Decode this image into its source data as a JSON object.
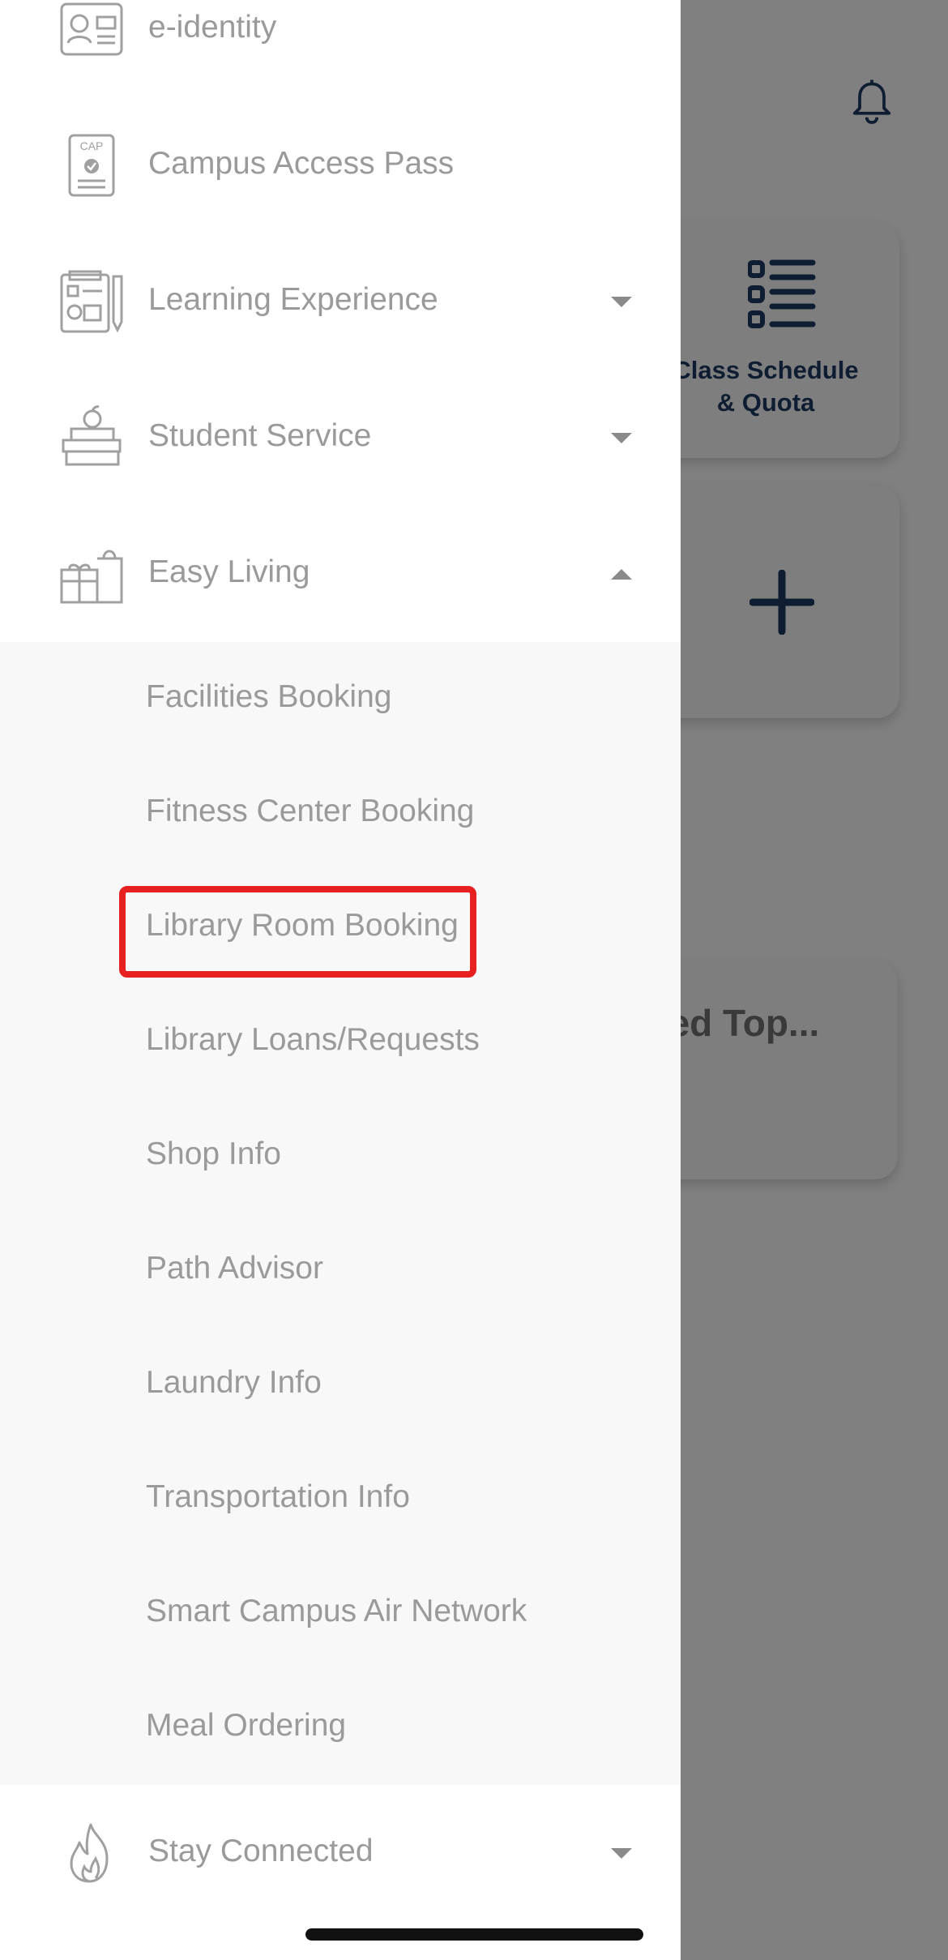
{
  "background": {
    "cards": [
      {
        "label": "Class Schedule\n& Quota",
        "icon": "list-icon"
      },
      {
        "label": "",
        "icon": "plus-icon"
      },
      {
        "label": "ced Top..."
      }
    ],
    "bell_icon": "bell-icon"
  },
  "drawer": {
    "menu": [
      {
        "label": "e-identity",
        "icon": "id-card-icon"
      },
      {
        "label": "Campus Access Pass",
        "icon": "cap-pass-icon"
      },
      {
        "label": "Learning Experience",
        "icon": "learning-icon",
        "expandable": true,
        "expanded": false
      },
      {
        "label": "Student Service",
        "icon": "student-service-icon",
        "expandable": true,
        "expanded": false
      },
      {
        "label": "Easy Living",
        "icon": "easy-living-icon",
        "expandable": true,
        "expanded": true
      }
    ],
    "easy_living_items": [
      "Facilities Booking",
      "Fitness Center Booking",
      "Library Room Booking",
      "Library Loans/Requests",
      "Shop Info",
      "Path Advisor",
      "Laundry Info",
      "Transportation Info",
      "Smart Campus Air Network",
      "Meal Ordering"
    ],
    "highlighted_item": "Library Room Booking",
    "stay_connected": {
      "label": "Stay Connected",
      "icon": "flame-icon",
      "expandable": true,
      "expanded": false
    }
  },
  "colors": {
    "highlight": "#e82020",
    "text": "#9a9a9a",
    "card_text": "#0f1d33"
  }
}
